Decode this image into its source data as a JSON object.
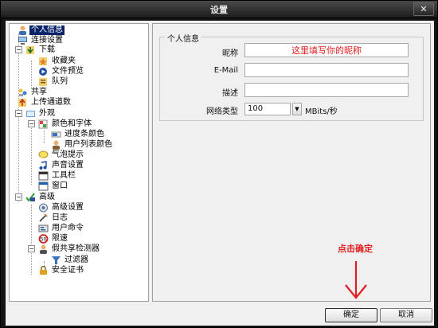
{
  "window": {
    "title": "设置",
    "close_label": "✕"
  },
  "tree": {
    "items": [
      {
        "label": "个人信息",
        "icon": "user-info-icon",
        "selected": true
      },
      {
        "label": "连接设置",
        "icon": "connection-icon"
      },
      {
        "label": "下载",
        "icon": "download-icon",
        "expander": "−"
      },
      {
        "label": "收藏夹",
        "icon": "favorites-icon"
      },
      {
        "label": "文件预览",
        "icon": "preview-icon"
      },
      {
        "label": "队列",
        "icon": "queue-icon"
      },
      {
        "label": "共享",
        "icon": "share-icon"
      },
      {
        "label": "上传通道数",
        "icon": "upload-slots-icon"
      },
      {
        "label": "外观",
        "icon": "appearance-icon",
        "expander": "−"
      },
      {
        "label": "颜色和字体",
        "icon": "color-font-icon",
        "expander": "−"
      },
      {
        "label": "进度条颜色",
        "icon": "progress-color-icon"
      },
      {
        "label": "用户列表颜色",
        "icon": "userlist-color-icon"
      },
      {
        "label": "气泡提示",
        "icon": "balloon-icon"
      },
      {
        "label": "声音设置",
        "icon": "sound-icon"
      },
      {
        "label": "工具栏",
        "icon": "toolbar-icon"
      },
      {
        "label": "窗口",
        "icon": "window-icon"
      },
      {
        "label": "高级",
        "icon": "advanced-icon",
        "expander": "−"
      },
      {
        "label": "高级设置",
        "icon": "advanced-settings-icon"
      },
      {
        "label": "日志",
        "icon": "log-icon"
      },
      {
        "label": "用户命令",
        "icon": "user-commands-icon"
      },
      {
        "label": "限速",
        "icon": "speed-limit-icon"
      },
      {
        "label": "假共享检测器",
        "icon": "fake-share-detector-icon",
        "expander": "−"
      },
      {
        "label": "过滤器",
        "icon": "filter-icon"
      },
      {
        "label": "安全证书",
        "icon": "certificate-icon"
      }
    ]
  },
  "personal_info": {
    "group_title": "个人信息",
    "nickname_label": "昵称",
    "nickname_value": "这里填写你的昵称",
    "email_label": "E-Mail",
    "email_value": "",
    "description_label": "描述",
    "description_value": "",
    "connection_type_label": "网络类型",
    "connection_type_value": "100",
    "connection_type_unit": "MBits/秒"
  },
  "annotation": {
    "text": "点击确定",
    "color": "#e02020"
  },
  "buttons": {
    "ok_label": "确定",
    "cancel_label": "取消"
  }
}
